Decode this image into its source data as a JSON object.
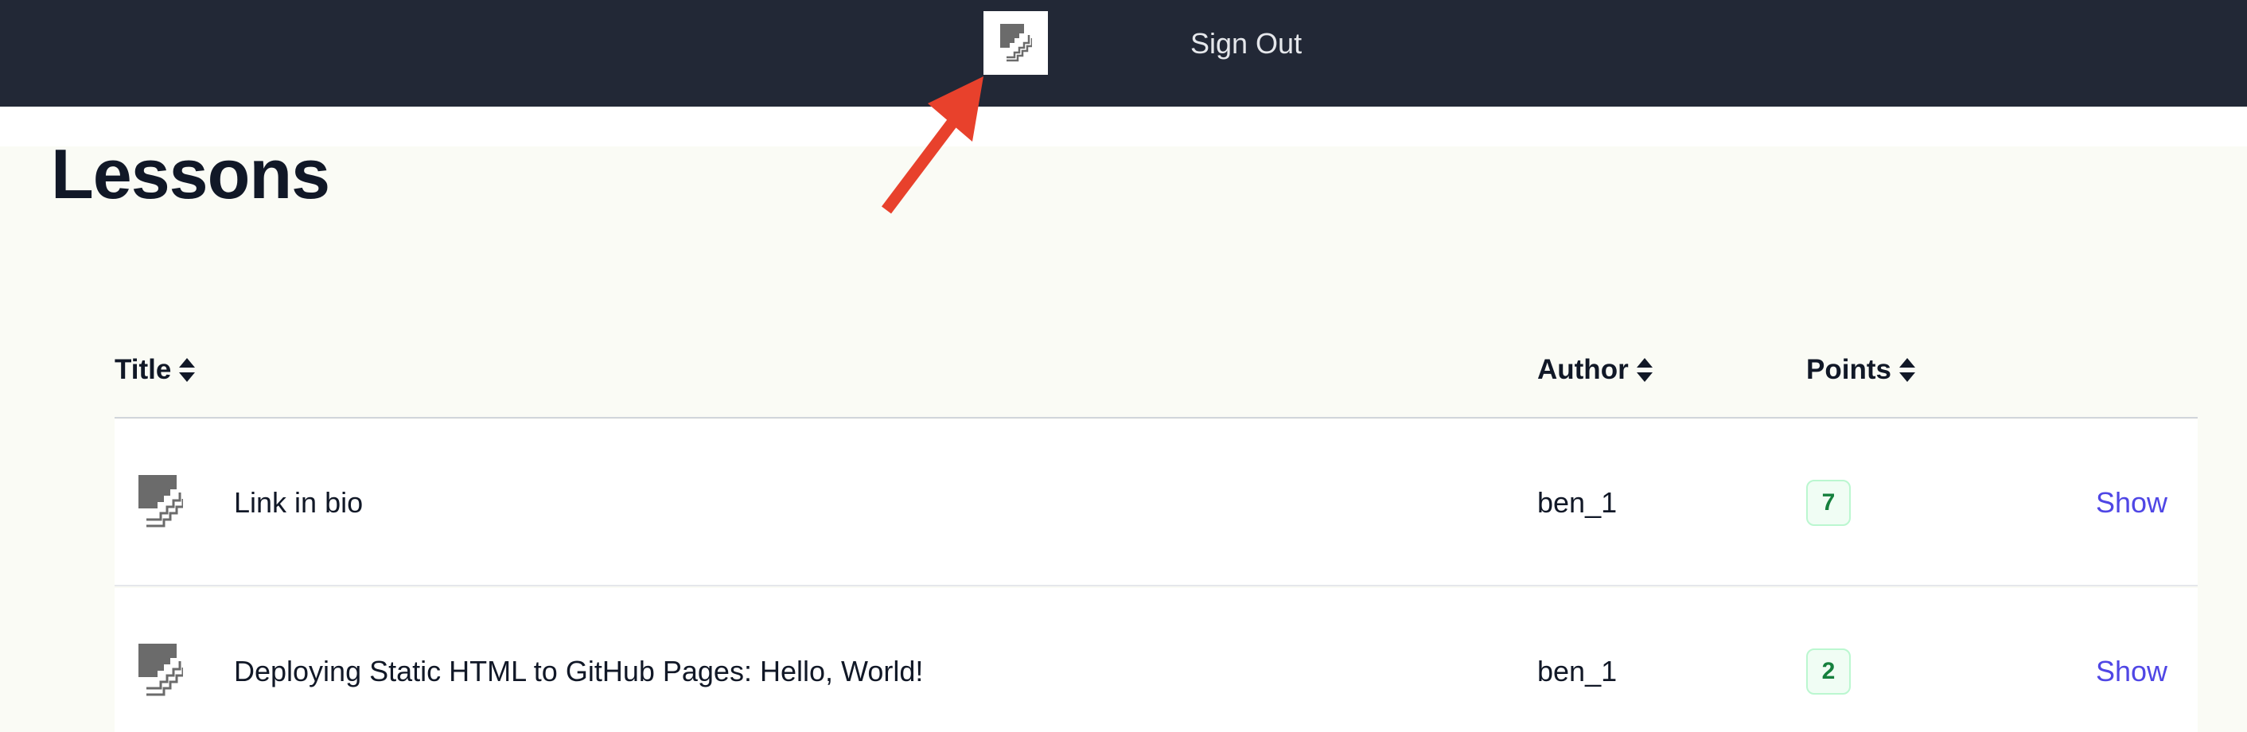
{
  "navbar": {
    "logo_icon": "stairs-logo-icon",
    "signout_label": "Sign Out"
  },
  "page": {
    "title": "Lessons"
  },
  "table": {
    "columns": {
      "title": "Title",
      "author": "Author",
      "points": "Points"
    },
    "sort_icon": "sort-up-down-icon",
    "rows": [
      {
        "thumb_icon": "stairs-thumbnail-icon",
        "title": "Link in bio",
        "author": "ben_1",
        "points": "7",
        "action": "Show"
      },
      {
        "thumb_icon": "stairs-thumbnail-icon",
        "title": "Deploying Static HTML to GitHub Pages: Hello, World!",
        "author": "ben_1",
        "points": "2",
        "action": "Show"
      }
    ]
  },
  "annotation": {
    "arrow_color": "#e8412c"
  },
  "colors": {
    "navbar_bg": "#222836",
    "page_bg": "#fafbf5",
    "link": "#4f46e5",
    "badge_text": "#15803d"
  }
}
